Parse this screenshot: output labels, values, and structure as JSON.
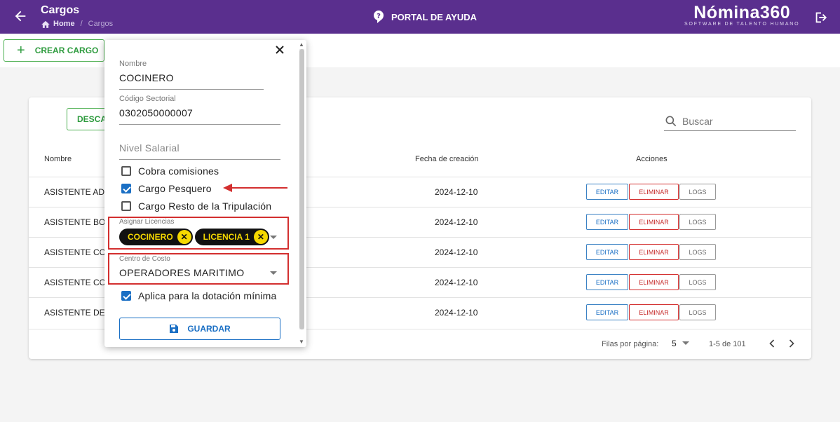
{
  "header": {
    "title": "Cargos",
    "breadcrumb_home": "Home",
    "breadcrumb_sep": "/",
    "breadcrumb_current": "Cargos",
    "help_label": "PORTAL DE AYUDA",
    "logo_name": "Nómina360",
    "logo_tagline": "SOFTWARE DE TALENTO HUMANO",
    "brand_color": "#5a2f8e"
  },
  "toolbar": {
    "crear_label": "CREAR CARGO"
  },
  "table": {
    "descargar_label": "DESCA",
    "search_placeholder": "Buscar",
    "columns": {
      "nombre": "Nombre",
      "fecha": "Fecha de creación",
      "acciones": "Acciones"
    },
    "rows": [
      {
        "nombre": "ASISTENTE ADM",
        "fecha": "2024-12-10"
      },
      {
        "nombre": "ASISTENTE BOD",
        "fecha": "2024-12-10"
      },
      {
        "nombre": "ASISTENTE CON",
        "fecha": "2024-12-10"
      },
      {
        "nombre": "ASISTENTE COS",
        "fecha": "2024-12-10"
      },
      {
        "nombre": "ASISTENTE DE C",
        "fecha": "2024-12-10"
      }
    ],
    "actions": {
      "editar": "EDITAR",
      "eliminar": "ELIMINAR",
      "logs": "LOGS"
    },
    "footer": {
      "rows_per_page_label": "Filas por página:",
      "rows_per_page": "5",
      "range": "1-5 de 101"
    }
  },
  "dialog": {
    "nombre_label": "Nombre",
    "nombre_value": "COCINERO",
    "codigo_label": "Código Sectorial",
    "codigo_value": "0302050000007",
    "nivel_placeholder": "Nivel Salarial",
    "checkboxes": [
      {
        "label": "Cobra comisiones",
        "checked": false
      },
      {
        "label": "Cargo Pesquero",
        "checked": true
      },
      {
        "label": "Cargo Resto de la Tripulación",
        "checked": false
      }
    ],
    "licencias_label": "Asignar Licencias",
    "licencias_chips": [
      "COCINERO",
      "LICENCIA 1"
    ],
    "centro_label": "Centro de Costo",
    "centro_value": "OPERADORES MARITIMO",
    "dotacion_label": "Aplica para la dotación mínima",
    "dotacion_checked": true,
    "guardar_label": "GUARDAR",
    "chip_color": "#f5d800",
    "highlight_color": "#d32f2f"
  }
}
